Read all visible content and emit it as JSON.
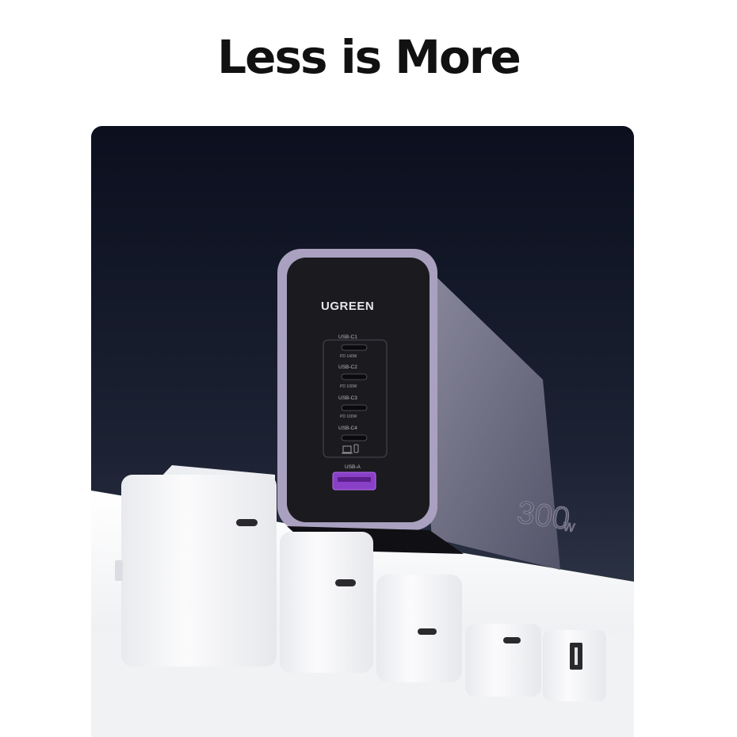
{
  "headline": "Less is More",
  "product": {
    "brand": "UGREEN",
    "wattage": "300",
    "wattage_unit": "w",
    "ports": [
      {
        "label": "USB-C1",
        "spec": "PD 140W"
      },
      {
        "label": "USB-C2",
        "spec": "PD 100W"
      },
      {
        "label": "USB-C3",
        "spec": "PD 100W"
      },
      {
        "label": "USB-C4",
        "spec": ""
      },
      {
        "label": "USB-A",
        "spec": ""
      }
    ]
  },
  "colors": {
    "background_top": "#0c1020",
    "background_bottom": "#3a4254",
    "charger_body": "#7b7a8c",
    "charger_face": "#1c1c1e",
    "charger_rim": "#a79fbd",
    "usb_a_accent": "#9b45d6",
    "white_chargers": "#f4f4f6"
  }
}
